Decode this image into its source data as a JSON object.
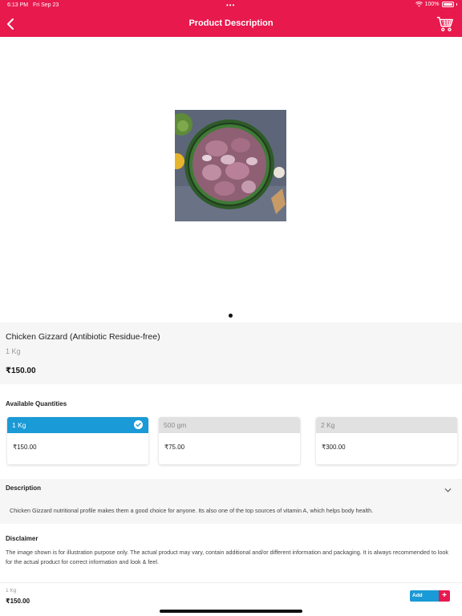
{
  "status_bar": {
    "time": "6:13 PM",
    "date": "Fri Sep 23",
    "dots": "•••",
    "battery": "100%"
  },
  "header": {
    "title": "Product Description"
  },
  "product": {
    "name": "Chicken Gizzard (Antibiotic Residue-free)",
    "unit": "1 Kg",
    "price": "₹150.00"
  },
  "quantities": {
    "heading": "Available Quantities",
    "options": [
      {
        "label": "1 Kg",
        "price": "₹150.00",
        "selected": true
      },
      {
        "label": "500 gm",
        "price": "₹75.00",
        "selected": false
      },
      {
        "label": "2 Kg",
        "price": "₹300.00",
        "selected": false
      }
    ]
  },
  "description": {
    "heading": "Description",
    "text": "Chicken Gizzard nutritional profile makes them a good choice for anyone. Its also one of the top sources of vitamin A, which helps body health."
  },
  "disclaimer": {
    "heading": "Disclaimer",
    "text": "The image shown is for illustration purpose only. The actual product may vary, contain additional and/or different information and packaging. It is always recommended to look for the actual product for correct information and look & feel."
  },
  "cart_bar": {
    "unit": "1 Kg",
    "price": "₹150.00",
    "add_label": "Add",
    "plus": "+"
  },
  "colors": {
    "brand": "#e8194d",
    "accent": "#1a9ad6"
  },
  "icons": [
    "back-icon",
    "cart-icon",
    "check-icon",
    "chevron-down-icon",
    "wifi-icon",
    "battery-icon"
  ]
}
